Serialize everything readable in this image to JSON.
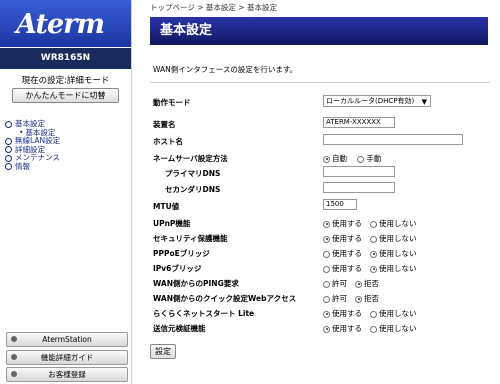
{
  "brand": "Aterm",
  "model": "WR8165N",
  "mode": {
    "current": "現在の設定:詳細モード",
    "switch_label": "かんたんモードに切替"
  },
  "nav": [
    {
      "label": "基本設定",
      "type": "parent"
    },
    {
      "label": "基本設定",
      "type": "sub"
    },
    {
      "label": "無線LAN設定",
      "type": "parent"
    },
    {
      "label": "詳細設定",
      "type": "parent"
    },
    {
      "label": "メンテナンス",
      "type": "parent"
    },
    {
      "label": "情報",
      "type": "parent"
    }
  ],
  "side_buttons": [
    "AtermStation",
    "機能詳細ガイド",
    "お客様登録"
  ],
  "breadcrumb": "トップページ > 基本設定 > 基本設定",
  "title": "基本設定",
  "description": "WAN側インタフェースの設定を行います。",
  "fields": {
    "op_mode": {
      "label": "動作モード",
      "value": "ローカルルータ(DHCP有効)"
    },
    "device_name": {
      "label": "装置名",
      "value": "ATERM-XXXXXX"
    },
    "host_name": {
      "label": "ホスト名",
      "value": ""
    },
    "dns_method": {
      "label": "ネームサーバ設定方法",
      "options": [
        "自動",
        "手動"
      ],
      "selected": 0
    },
    "primary_dns": {
      "label": "プライマリDNS",
      "value": ""
    },
    "secondary_dns": {
      "label": "セカンダリDNS",
      "value": ""
    },
    "mtu": {
      "label": "MTU値",
      "value": "1500"
    }
  },
  "radios": [
    {
      "label": "UPnP機能",
      "options": [
        "使用する",
        "使用しない"
      ],
      "selected": 0
    },
    {
      "label": "セキュリティ保護機能",
      "options": [
        "使用する",
        "使用しない"
      ],
      "selected": 0
    },
    {
      "label": "PPPoEブリッジ",
      "options": [
        "使用する",
        "使用しない"
      ],
      "selected": 1
    },
    {
      "label": "IPv6ブリッジ",
      "options": [
        "使用する",
        "使用しない"
      ],
      "selected": 1
    },
    {
      "label": "WAN側からのPING要求",
      "options": [
        "許可",
        "拒否"
      ],
      "selected": 1
    },
    {
      "label": "WAN側からのクイック設定Webアクセス",
      "options": [
        "許可",
        "拒否"
      ],
      "selected": 1
    },
    {
      "label": "らくらくネットスタート Lite",
      "options": [
        "使用する",
        "使用しない"
      ],
      "selected": 0
    },
    {
      "label": "送信元検証機能",
      "options": [
        "使用する",
        "使用しない"
      ],
      "selected": 0
    }
  ],
  "apply_label": "設定"
}
